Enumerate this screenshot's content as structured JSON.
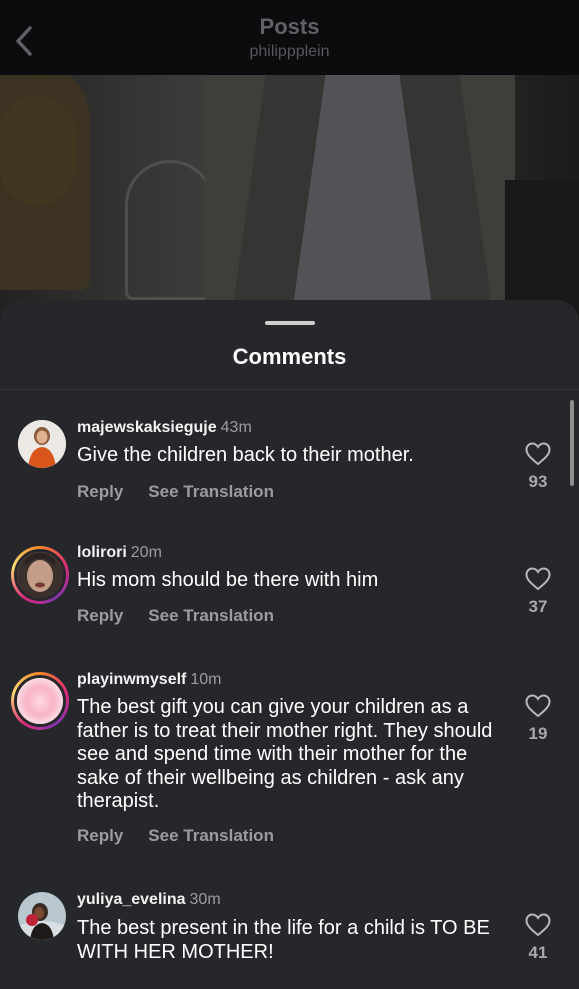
{
  "header": {
    "title": "Posts",
    "subtitle": "philippplein"
  },
  "sheet": {
    "title": "Comments"
  },
  "comments": [
    {
      "username": "majewskaksieguje",
      "time": "43m",
      "text": "Give the children back to their mother.",
      "reply_label": "Reply",
      "translate_label": "See Translation",
      "likes": "93",
      "avatar_color": "#c85a1e"
    },
    {
      "username": "lolirori",
      "time": "20m",
      "text": "His mom should be there with him",
      "reply_label": "Reply",
      "translate_label": "See Translation",
      "likes": "37",
      "avatar_color": "#9a7a6a"
    },
    {
      "username": "playinwmyself",
      "time": "10m",
      "text": "The best gift you can give your children as a father is to treat their mother right. They should see and spend time with their mother for the sake of their wellbeing as children - ask any therapist.",
      "reply_label": "Reply",
      "translate_label": "See Translation",
      "likes": "19",
      "avatar_color": "#f3d6dc"
    },
    {
      "username": "yuliya_evelina",
      "time": "30m",
      "text": "The best present in the life for a child is TO BE WITH HER MOTHER!",
      "likes": "41",
      "avatar_color": "#c0223a"
    }
  ]
}
